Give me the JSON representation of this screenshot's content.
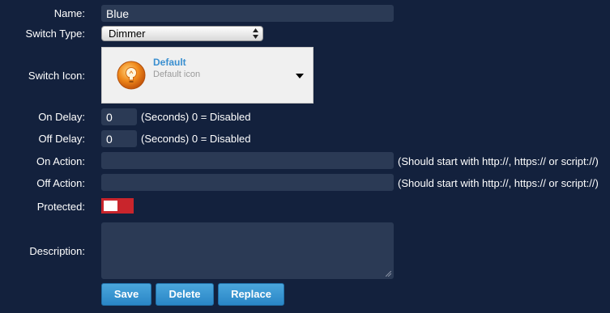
{
  "form": {
    "name": {
      "label": "Name:",
      "value": "Blue"
    },
    "switch_type": {
      "label": "Switch Type:",
      "value": "Dimmer"
    },
    "switch_icon": {
      "label": "Switch Icon:",
      "title": "Default",
      "subtitle": "Default icon",
      "icon": "lightbulb-icon"
    },
    "on_delay": {
      "label": "On Delay:",
      "value": "0",
      "hint": "(Seconds) 0 = Disabled"
    },
    "off_delay": {
      "label": "Off Delay:",
      "value": "0",
      "hint": "(Seconds) 0 = Disabled"
    },
    "on_action": {
      "label": "On Action:",
      "value": "",
      "hint": "(Should start with http://, https:// or script://)"
    },
    "off_action": {
      "label": "Off Action:",
      "value": "",
      "hint": "(Should start with http://, https:// or script://)"
    },
    "protected": {
      "label": "Protected:",
      "on": false
    },
    "description": {
      "label": "Description:",
      "value": ""
    }
  },
  "buttons": {
    "save": "Save",
    "delete": "Delete",
    "replace": "Replace"
  },
  "colors": {
    "background": "#13213d",
    "input_bg": "#2b3a55",
    "toggle_off": "#c9252c",
    "button": "#3a96d4",
    "icon_title": "#3a8fd0"
  }
}
